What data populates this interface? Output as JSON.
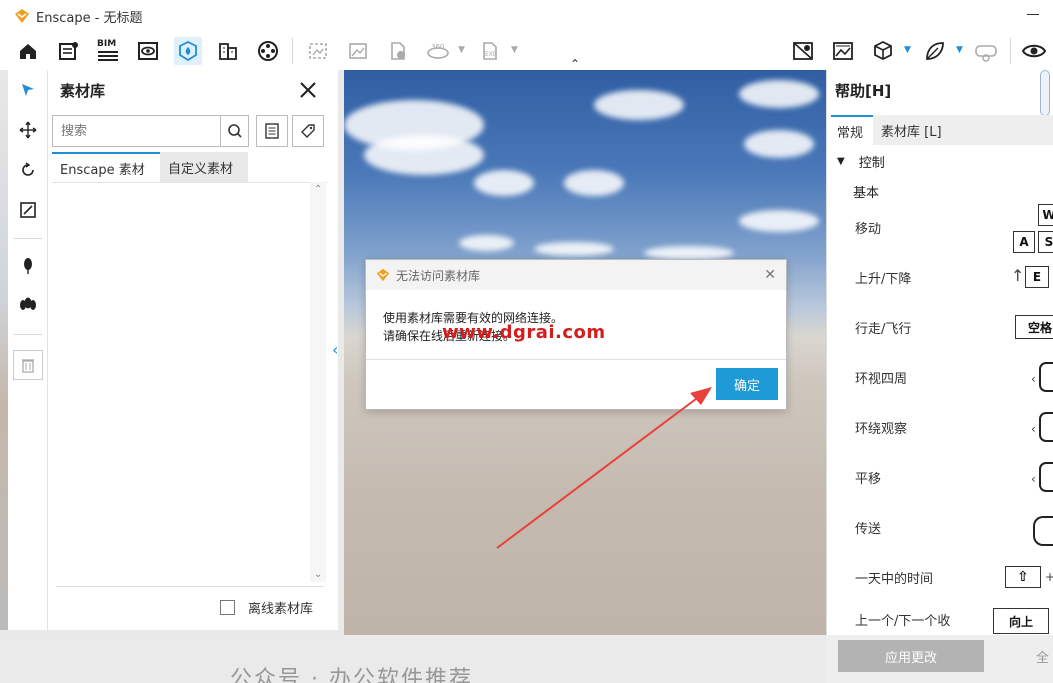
{
  "window": {
    "title": "Enscape - 无标题"
  },
  "toolbar": {
    "bim_label": "BIM",
    "icons": [
      "home-icon",
      "document-settings-icon",
      "bim-icon",
      "visual-settings-icon",
      "asset-library-icon",
      "buildings-icon",
      "film-reel-icon",
      "screenshot-icon",
      "image-icon",
      "export-file-icon",
      "panorama-360-icon",
      "exe-export-icon",
      "map-icon",
      "gallery-icon",
      "cube-icon",
      "leaf-icon",
      "vr-headset-icon",
      "eye-icon"
    ]
  },
  "asset_panel": {
    "title": "素材库",
    "search_placeholder": "搜索",
    "tabs": [
      "Enscape 素材",
      "自定义素材"
    ],
    "offline_label": "离线素材库"
  },
  "dialog": {
    "title": "无法访问素材库",
    "message_line1": "使用素材库需要有效的网络连接。",
    "message_line2": "请确保在线后重新连接。",
    "watermark": "www.dgrai.com",
    "ok_label": "确定"
  },
  "help_panel": {
    "title": "帮助[H]",
    "tabs": [
      "常规",
      "素材库 [L]"
    ],
    "section": "控制",
    "subsection": "基本",
    "rows": [
      {
        "label": "移动"
      },
      {
        "label": "上升/下降"
      },
      {
        "label": "行走/飞行"
      },
      {
        "label": "环视四周"
      },
      {
        "label": "环绕观察"
      },
      {
        "label": "平移"
      },
      {
        "label": "传送"
      },
      {
        "label": "一天中的时间"
      },
      {
        "label": "上一个/下一个收"
      }
    ],
    "keys": {
      "w": "W",
      "a": "A",
      "s": "S",
      "e": "E",
      "space": "空格",
      "up": "向上"
    },
    "apply_label": "应用更改",
    "right_cut_label": "全"
  },
  "bottom_overlay": {
    "text": "公众号 · 办公软件推荐"
  },
  "colors": {
    "accent": "#1e9ad6",
    "brand_orange": "#f0a020",
    "watermark_red": "#d41d1d",
    "arrow_red": "#e8403a"
  }
}
